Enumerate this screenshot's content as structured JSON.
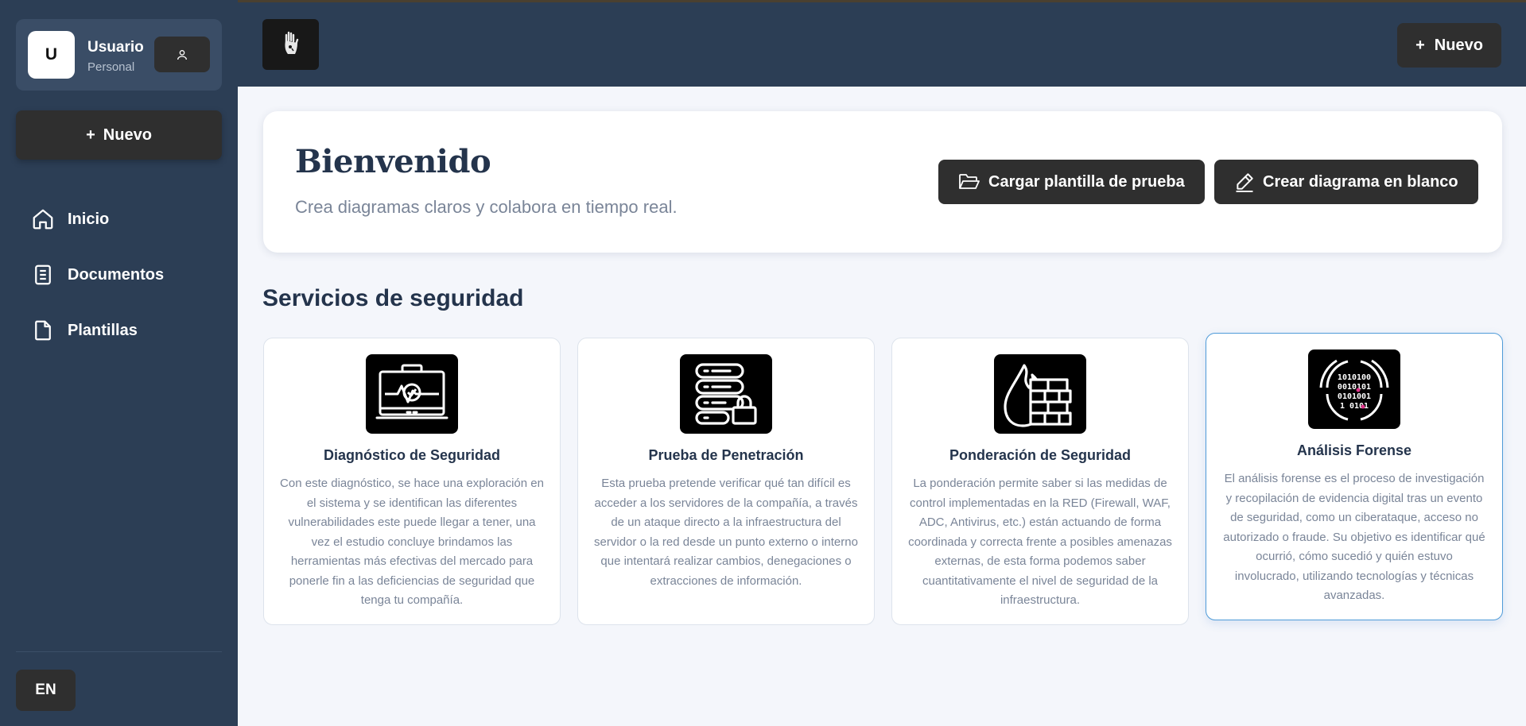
{
  "sidebar": {
    "user": {
      "initial": "U",
      "name": "Usuario",
      "plan": "Personal"
    },
    "new_label": "Nuevo",
    "nav": [
      {
        "label": "Inicio",
        "icon": "home-icon"
      },
      {
        "label": "Documentos",
        "icon": "document-icon"
      },
      {
        "label": "Plantillas",
        "icon": "file-icon"
      }
    ],
    "language": "EN"
  },
  "topbar": {
    "new_label": "Nuevo"
  },
  "welcome": {
    "title": "Bienvenido",
    "subtitle": "Crea diagramas claros y colabora en tiempo real.",
    "load_template_label": "Cargar plantilla de prueba",
    "blank_diagram_label": "Crear diagrama en blanco"
  },
  "services": {
    "title": "Servicios de seguridad",
    "cards": [
      {
        "title": "Diagnóstico de Seguridad",
        "description": "Con este diagnóstico, se hace una exploración en el sistema y se identifican las diferentes vulnerabilidades este puede llegar a tener, una vez el estudio concluye brindamos las herramientas más efectivas del mercado para ponerle fin a las deficiencias de seguridad que tenga tu compañía.",
        "icon": "monitor-heartbeat-icon"
      },
      {
        "title": "Prueba de Penetración",
        "description": "Esta prueba pretende verificar qué tan difícil es acceder a los servidores de la compañía, a través de un ataque directo a la infraestructura del servidor o la red desde un punto externo o interno que intentará realizar cambios, denegaciones o extracciones de información.",
        "icon": "server-lock-icon"
      },
      {
        "title": "Ponderación de Seguridad",
        "description": "La ponderación permite saber si las medidas de control implementadas en la RED (Firewall, WAF, ADC, Antivirus, etc.) están actuando de forma coordinada y correcta frente a posibles amenazas externas, de esta forma podemos saber cuantitativamente el nivel de seguridad de la infraestructura.",
        "icon": "firewall-icon"
      },
      {
        "title": "Análisis Forense",
        "description": "El análisis forense es el proceso de investigación y recopilación de evidencia digital tras un evento de seguridad, como un ciberataque, acceso no autorizado o fraude. Su objetivo es identificar qué ocurrió, cómo sucedió y quién estuvo involucrado, utilizando tecnologías y técnicas avanzadas.",
        "icon": "binary-forensics-icon",
        "binary_lines": [
          "1010100",
          "0010101",
          "0101001",
          "1 0101"
        ]
      }
    ]
  }
}
